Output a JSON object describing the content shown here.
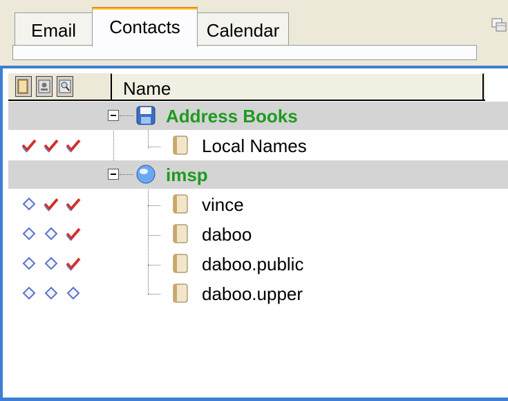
{
  "tabs": [
    {
      "label": "Email",
      "active": false
    },
    {
      "label": "Contacts",
      "active": true
    },
    {
      "label": "Calendar",
      "active": false
    }
  ],
  "header": {
    "name_column": "Name",
    "column_icons": [
      "open-book-icon",
      "address-card-icon",
      "search-book-icon"
    ]
  },
  "tree": {
    "groups": [
      {
        "label": "Address Books",
        "icon": "floppy-disk-icon",
        "expanded": true,
        "items": [
          {
            "label": "Local Names",
            "icon": "address-book-icon",
            "flags": [
              "check",
              "check",
              "check"
            ]
          }
        ]
      },
      {
        "label": "imsp",
        "icon": "globe-icon",
        "expanded": true,
        "items": [
          {
            "label": "vince",
            "icon": "address-book-icon",
            "flags": [
              "diamond",
              "check",
              "check"
            ]
          },
          {
            "label": "daboo",
            "icon": "address-book-icon",
            "flags": [
              "diamond",
              "diamond",
              "check"
            ]
          },
          {
            "label": "daboo.public",
            "icon": "address-book-icon",
            "flags": [
              "diamond",
              "diamond",
              "check"
            ]
          },
          {
            "label": "daboo.upper",
            "icon": "address-book-icon",
            "flags": [
              "diamond",
              "diamond",
              "diamond"
            ]
          }
        ]
      }
    ]
  },
  "colors": {
    "accent": "#3c7fd4",
    "group_text": "#1f9a1f",
    "group_row_bg": "#d4d4d4",
    "check": "#d0302a",
    "diamond": "#5a72c8"
  }
}
